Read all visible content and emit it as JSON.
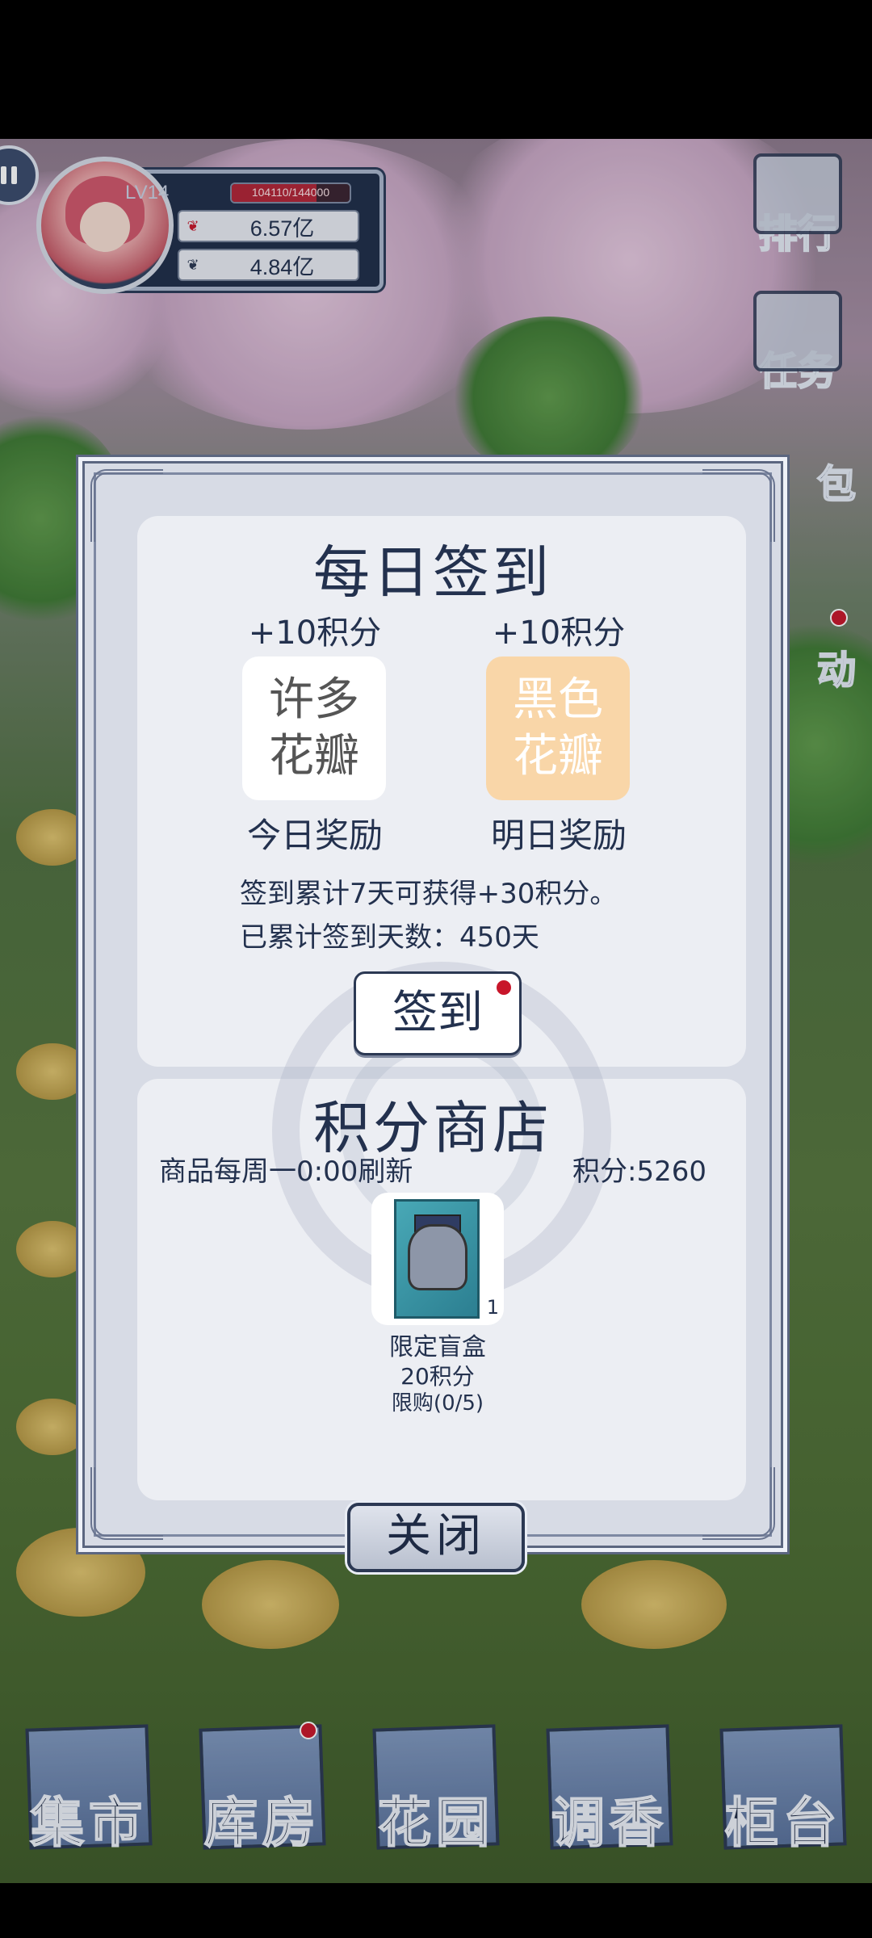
{
  "hud": {
    "level": "LV14",
    "xp_text": "104110/144000",
    "xp_progress": 0.72,
    "stat1_value": "6.57亿",
    "stat2_value": "4.84亿"
  },
  "side_menu": {
    "rank": "排行",
    "task": "任务",
    "bag": "包",
    "event": "动"
  },
  "daily_signin": {
    "title": "每日签到",
    "today_points": "+10积分",
    "tomorrow_points": "+10积分",
    "today_reward": "许多花瓣",
    "tomorrow_reward": "黑色花瓣",
    "today_label": "今日奖励",
    "tomorrow_label": "明日奖励",
    "bonus_info": "签到累计7天可获得+30积分。",
    "total_days_info": "已累计签到天数：450天",
    "sign_button": "签到"
  },
  "points_shop": {
    "title": "积分商店",
    "refresh_info": "商品每周一0:00刷新",
    "points_balance": "积分:5260",
    "item": {
      "quantity": "1",
      "name": "限定盲盒",
      "price": "20积分",
      "limit": "限购(0/5)"
    }
  },
  "close_button": "关闭",
  "bottom_nav": [
    "集市",
    "库房",
    "花园",
    "调香",
    "柜台"
  ],
  "colors": {
    "accent_red": "#c8162a",
    "text_navy": "#23314e",
    "tomorrow_reward_bg": "#f9d6a8"
  }
}
